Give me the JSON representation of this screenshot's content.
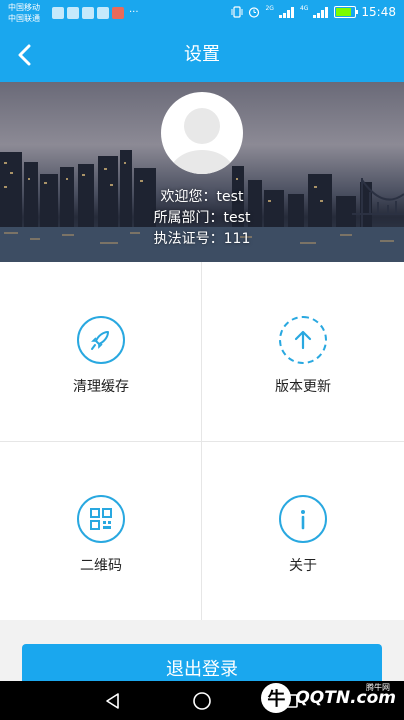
{
  "status_bar": {
    "carrier_1": "中国移动",
    "carrier_2": "中国联通",
    "more": "···",
    "net_1": "2G",
    "net_2": "4G",
    "time": "15:48",
    "battery_color": "#7CFC00"
  },
  "header": {
    "title": "设置",
    "back_icon": "chevron-left-icon"
  },
  "profile": {
    "welcome": "欢迎您：test",
    "department": "所属部门：test",
    "license": "执法证号：111"
  },
  "menu": {
    "items": [
      {
        "label": "清理缓存",
        "icon": "rocket-icon"
      },
      {
        "label": "版本更新",
        "icon": "upload-arrow-icon"
      },
      {
        "label": "二维码",
        "icon": "qr-code-icon"
      },
      {
        "label": "关于",
        "icon": "info-icon"
      }
    ]
  },
  "logout_label": "退出登录",
  "watermark": {
    "brand": "QQTN.com",
    "small": "腾牛网",
    "glyph": "牛"
  },
  "colors": {
    "primary": "#1aa7ee",
    "icon_accent": "#29a8e0"
  }
}
